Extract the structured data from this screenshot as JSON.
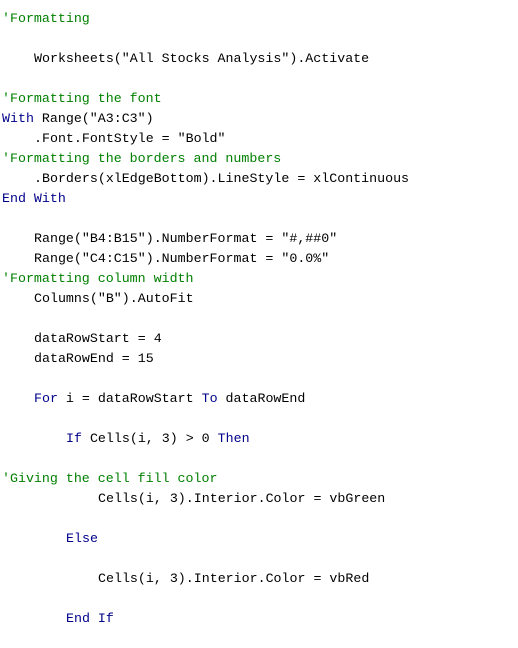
{
  "editor": {
    "colors": {
      "background": "#ffffff",
      "plain": "#000000",
      "comment": "#008000",
      "keyword": "#00008b"
    },
    "lines": [
      {
        "indent": 0,
        "tokens": [
          {
            "type": "comment",
            "text": "'Formatting"
          }
        ]
      },
      {
        "indent": 4,
        "tokens": [
          {
            "type": "plain",
            "text": "Worksheets(\"All Stocks Analysis\").Activate"
          }
        ]
      },
      {
        "indent": 0,
        "tokens": [
          {
            "type": "comment",
            "text": "'Formatting the font"
          }
        ]
      },
      {
        "indent": 0,
        "tokens": [
          {
            "type": "keyword",
            "text": "With"
          },
          {
            "type": "plain",
            "text": " Range(\"A3:C3\")"
          }
        ]
      },
      {
        "indent": 4,
        "tokens": [
          {
            "type": "plain",
            "text": ".Font.FontStyle = \"Bold\""
          }
        ]
      },
      {
        "indent": 0,
        "tokens": [
          {
            "type": "comment",
            "text": "'Formatting the borders and numbers"
          }
        ]
      },
      {
        "indent": 4,
        "tokens": [
          {
            "type": "plain",
            "text": ".Borders(xlEdgeBottom).LineStyle = xlContinuous"
          }
        ]
      },
      {
        "indent": 0,
        "tokens": [
          {
            "type": "keyword",
            "text": "End With"
          }
        ]
      },
      {
        "indent": 4,
        "tokens": [
          {
            "type": "plain",
            "text": "Range(\"B4:B15\").NumberFormat = \"#,##0\""
          }
        ]
      },
      {
        "indent": 4,
        "tokens": [
          {
            "type": "plain",
            "text": "Range(\"C4:C15\").NumberFormat = \"0.0%\""
          }
        ]
      },
      {
        "indent": 0,
        "tokens": [
          {
            "type": "comment",
            "text": "'Formatting column width"
          }
        ]
      },
      {
        "indent": 4,
        "tokens": [
          {
            "type": "plain",
            "text": "Columns(\"B\").AutoFit"
          }
        ]
      },
      {
        "indent": 4,
        "tokens": [
          {
            "type": "plain",
            "text": "dataRowStart = 4"
          }
        ]
      },
      {
        "indent": 4,
        "tokens": [
          {
            "type": "plain",
            "text": "dataRowEnd = 15"
          }
        ]
      },
      {
        "indent": 4,
        "tokens": [
          {
            "type": "keyword",
            "text": "For"
          },
          {
            "type": "plain",
            "text": " i = dataRowStart "
          },
          {
            "type": "keyword",
            "text": "To"
          },
          {
            "type": "plain",
            "text": " dataRowEnd"
          }
        ]
      },
      {
        "indent": 8,
        "tokens": [
          {
            "type": "keyword",
            "text": "If"
          },
          {
            "type": "plain",
            "text": " Cells(i, 3) > 0 "
          },
          {
            "type": "keyword",
            "text": "Then"
          }
        ]
      },
      {
        "indent": 0,
        "tokens": [
          {
            "type": "comment",
            "text": "'Giving the cell fill color"
          }
        ]
      },
      {
        "indent": 12,
        "tokens": [
          {
            "type": "plain",
            "text": "Cells(i, 3).Interior.Color = vbGreen"
          }
        ]
      },
      {
        "indent": 8,
        "tokens": [
          {
            "type": "keyword",
            "text": "Else"
          }
        ]
      },
      {
        "indent": 12,
        "tokens": [
          {
            "type": "plain",
            "text": "Cells(i, 3).Interior.Color = vbRed"
          }
        ]
      },
      {
        "indent": 8,
        "tokens": [
          {
            "type": "keyword",
            "text": "End If"
          }
        ]
      }
    ]
  }
}
